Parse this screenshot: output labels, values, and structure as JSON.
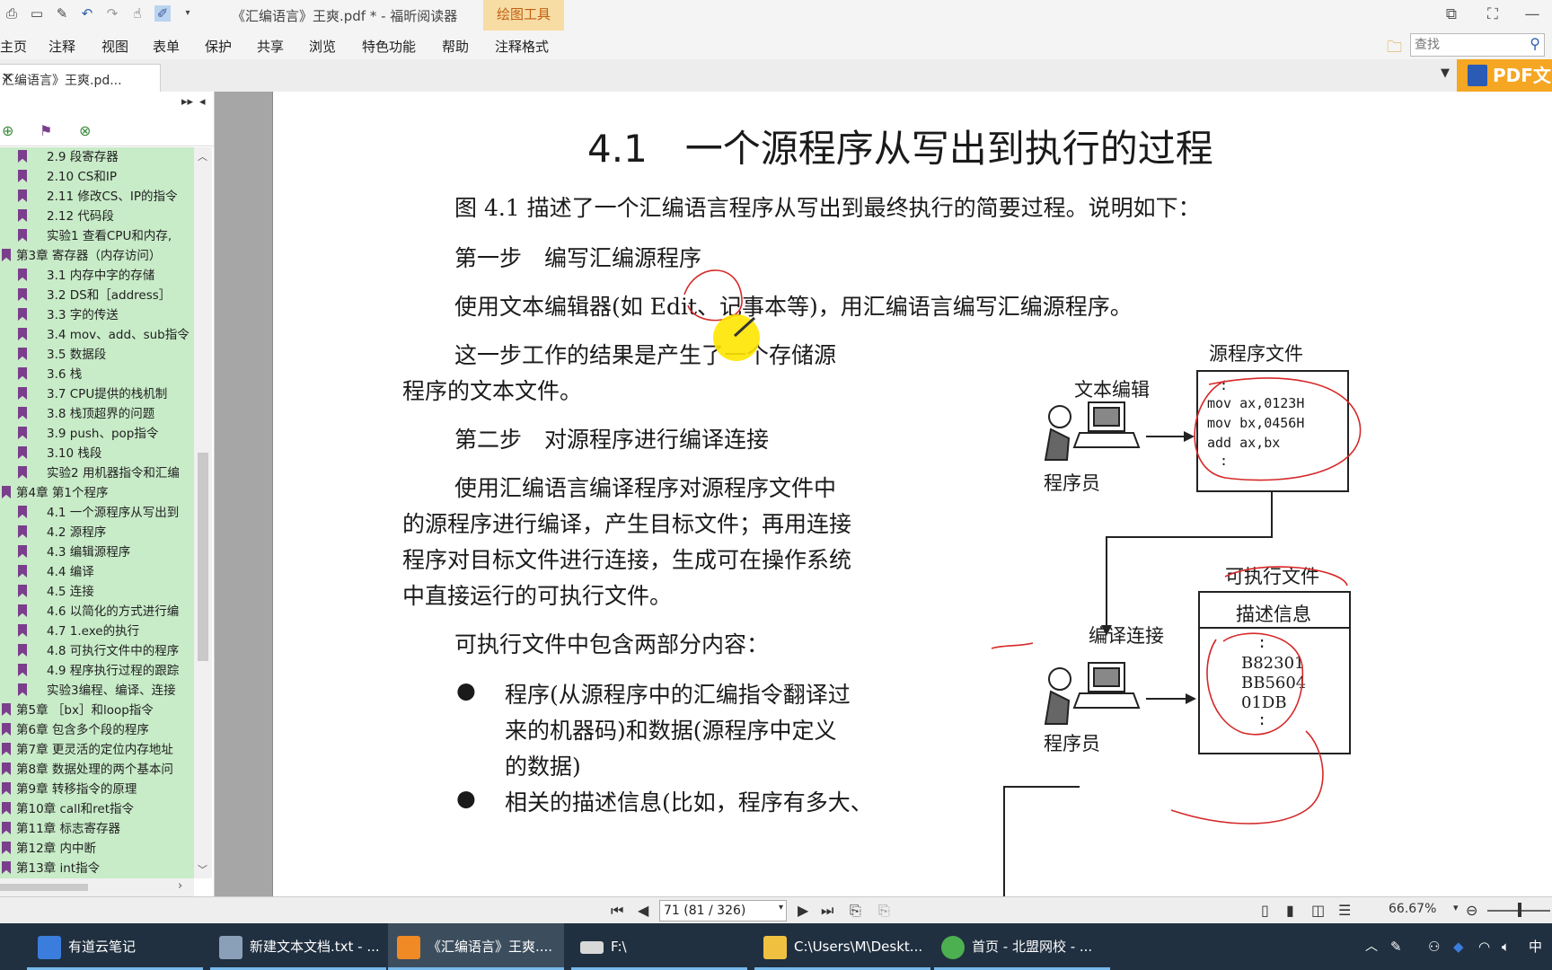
{
  "window": {
    "title": "《汇编语言》王爽.pdf * - 福昕阅读器",
    "tool_tab": "绘图工具"
  },
  "menu": [
    "主页",
    "注释",
    "视图",
    "表单",
    "保护",
    "共享",
    "浏览",
    "特色功能",
    "帮助",
    "注释格式"
  ],
  "search": {
    "placeholder": "查找"
  },
  "doc_tab": {
    "label": "汇编语言》王爽.pd...",
    "close": "✕"
  },
  "pdf_button": {
    "label": "PDF文"
  },
  "bookmarks": [
    {
      "label": "2.9  段寄存器",
      "indent": 2
    },
    {
      "label": "2.10  CS和IP",
      "indent": 2
    },
    {
      "label": "2.11  修改CS、IP的指令",
      "indent": 2
    },
    {
      "label": "2.12  代码段",
      "indent": 2
    },
    {
      "label": "实验1  查看CPU和内存,",
      "indent": 2
    },
    {
      "label": "第3章  寄存器（内存访问）",
      "indent": 1
    },
    {
      "label": "3.1  内存中字的存储",
      "indent": 2
    },
    {
      "label": "3.2  DS和［address］",
      "indent": 2
    },
    {
      "label": "3.3  字的传送",
      "indent": 2
    },
    {
      "label": "3.4  mov、add、sub指令",
      "indent": 2
    },
    {
      "label": "3.5  数据段",
      "indent": 2
    },
    {
      "label": "3.6  栈",
      "indent": 2
    },
    {
      "label": "3.7  CPU提供的栈机制",
      "indent": 2
    },
    {
      "label": "3.8  栈顶超界的问题",
      "indent": 2
    },
    {
      "label": "3.9  push、pop指令",
      "indent": 2
    },
    {
      "label": "3.10  栈段",
      "indent": 2
    },
    {
      "label": "实验2  用机器指令和汇编",
      "indent": 2
    },
    {
      "label": "第4章  第1个程序",
      "indent": 1
    },
    {
      "label": "4.1  一个源程序从写出到",
      "indent": 2
    },
    {
      "label": "4.2  源程序",
      "indent": 2
    },
    {
      "label": "4.3  编辑源程序",
      "indent": 2
    },
    {
      "label": "4.4  编译",
      "indent": 2
    },
    {
      "label": "4.5  连接",
      "indent": 2
    },
    {
      "label": "4.6  以简化的方式进行编",
      "indent": 2
    },
    {
      "label": "4.7  1.exe的执行",
      "indent": 2
    },
    {
      "label": "4.8  可执行文件中的程序",
      "indent": 2
    },
    {
      "label": "4.9  程序执行过程的跟踪",
      "indent": 2
    },
    {
      "label": "实验3编程、编译、连接",
      "indent": 2
    },
    {
      "label": "第5章  ［bx］和loop指令",
      "indent": 1
    },
    {
      "label": "第6章  包含多个段的程序",
      "indent": 1
    },
    {
      "label": "第7章  更灵活的定位内存地址",
      "indent": 1
    },
    {
      "label": "第8章  数据处理的两个基本问",
      "indent": 1
    },
    {
      "label": "第9章  转移指令的原理",
      "indent": 1
    },
    {
      "label": "第10章  call和ret指令",
      "indent": 1
    },
    {
      "label": "第11章  标志寄存器",
      "indent": 1
    },
    {
      "label": "第12章  内中断",
      "indent": 1
    },
    {
      "label": "第13章  int指令",
      "indent": 1
    }
  ],
  "page": {
    "heading": "4.1　一个源程序从写出到执行的过程",
    "p1": "图 4.1 描述了一个汇编语言程序从写出到最终执行的简要过程。说明如下：",
    "step1": "第一步　编写汇编源程序",
    "p2": "使用文本编辑器(如 Edit、记事本等)，用汇编语言编写汇编源程序。",
    "p3a": "这一步工作的结果是产生了一个存储源",
    "p3b": "程序的文本文件。",
    "step2": "第二步　对源程序进行编译连接",
    "p4a": "使用汇编语言编译程序对源程序文件中",
    "p4b": "的源程序进行编译，产生目标文件；再用连接",
    "p4c": "程序对目标文件进行连接，生成可在操作系统",
    "p4d": "中直接运行的可执行文件。",
    "p5": "可执行文件中包含两部分内容：",
    "b1a": "程序(从源程序中的汇编指令翻译过",
    "b1b": "来的机器码)和数据(源程序中定义",
    "b1c": "的数据)",
    "b2a": "相关的描述信息(比如，程序有多大、"
  },
  "figure": {
    "source_title": "源程序文件",
    "editor_label": "文本编辑",
    "programmer1": "程序员",
    "code": [
      ":",
      "mov ax,0123H",
      "mov bx,0456H",
      "add ax,bx",
      ":"
    ],
    "exe_title": "可执行文件",
    "desc_info": "描述信息",
    "compile_link": "编译连接",
    "machine": [
      ":",
      "B82301",
      "BB5604",
      "01DB",
      ":"
    ],
    "programmer2": "程序员"
  },
  "statusbar": {
    "page_field": "71 (81 / 326)",
    "zoom": "66.67%"
  },
  "taskbar": [
    {
      "label": "有道云笔记",
      "color": "#3b7ddd"
    },
    {
      "label": "新建文本文档.txt - ...",
      "color": "#8aa0b8"
    },
    {
      "label": "《汇编语言》王爽....",
      "color": "#f08a24"
    },
    {
      "label": "F:\\",
      "color": "#d8d8d8"
    },
    {
      "label": "C:\\Users\\M\\Deskt...",
      "color": "#f0c040"
    },
    {
      "label": "首页 - 北盟网校 - ...",
      "color": "#4caf50"
    }
  ],
  "tray": {
    "ime": "中"
  }
}
